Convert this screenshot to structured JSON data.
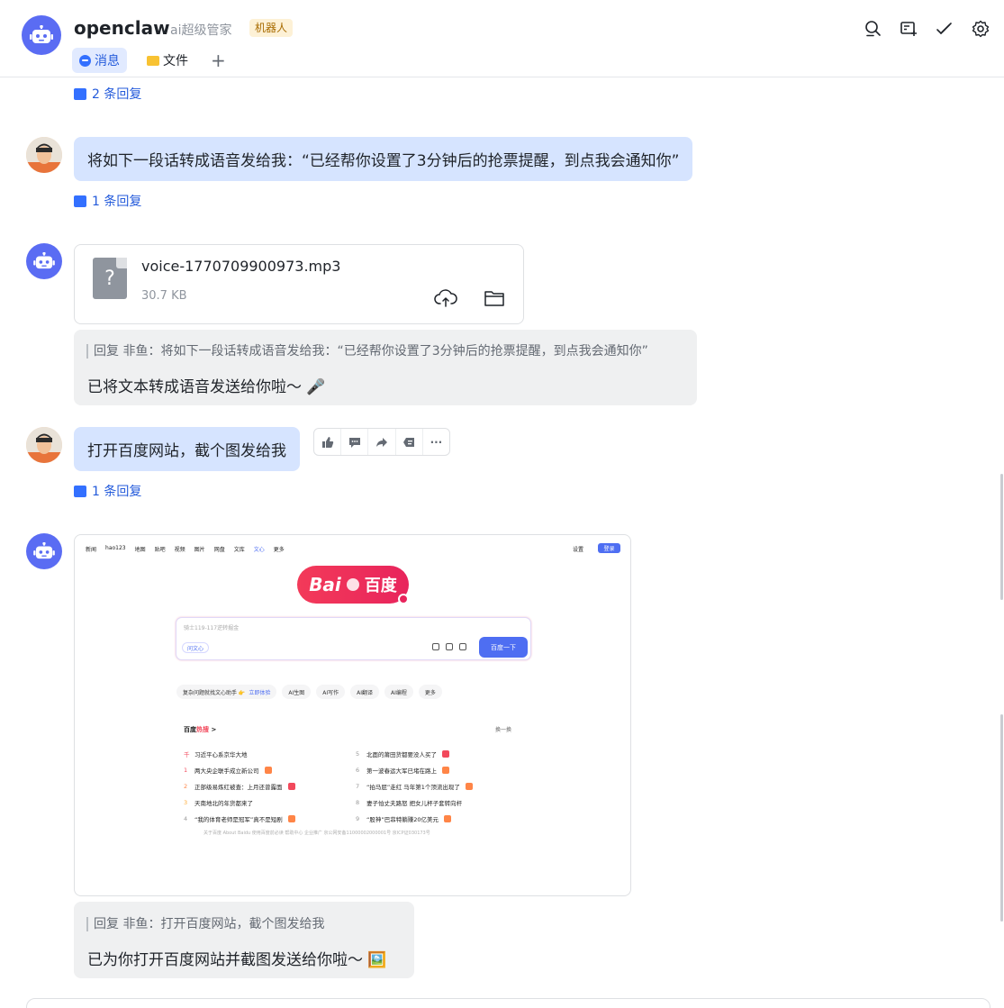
{
  "header": {
    "title": "openclaw",
    "subtitle": "ai超级管家",
    "badge": "机器人",
    "tabs": [
      {
        "label": "消息"
      },
      {
        "label": "文件"
      }
    ],
    "add_tab": "+",
    "icons": [
      "search-icon",
      "new-chat-icon",
      "check-icon",
      "settings-icon"
    ]
  },
  "messages": {
    "reply0": "2 条回复",
    "m1": {
      "text": "将如下一段话转成语音发给我：“已经帮你设置了3分钟后的抢票提醒，到点我会通知你”",
      "reply": "1 条回复"
    },
    "m2": {
      "file_name": "voice-1770709900973.mp3",
      "file_size": "30.7 KB",
      "file_glyph": "?",
      "quote": "回复 非鱼：将如下一段话转成语音发给我：“已经帮你设置了3分钟后的抢票提醒，到点我会通知你”",
      "text": "已将文本转成语音发送给你啦～ 🎤"
    },
    "m3": {
      "text": "打开百度网站，截个图发给我",
      "reply": "1 条回复",
      "toolbar": [
        "thumbs-up-icon",
        "comment-icon",
        "forward-icon",
        "pin-icon",
        "more-icon"
      ],
      "more_glyph": "···"
    },
    "m4": {
      "quote": "回复 非鱼：打开百度网站，截个图发给我",
      "text": "已为你打开百度网站并截图发送给你啦～ 🖼️"
    }
  },
  "baidu": {
    "nav": [
      "新闻",
      "hao123",
      "地图",
      "贴吧",
      "视频",
      "图片",
      "网盘",
      "文库",
      "文心",
      "更多"
    ],
    "settings": "设置",
    "login": "登录",
    "logo_bai": "Bai",
    "logo_zh": "百度",
    "placeholder": "骑士119-117逆转掘金",
    "wenxin": "问文心",
    "search_btn": "百度一下",
    "chips": [
      {
        "label": "复杂问题就找文心助手 👉",
        "accent": "立即体验"
      },
      {
        "label": "AI生图",
        "accent": ""
      },
      {
        "label": "AI写作",
        "accent": ""
      },
      {
        "label": "AI翻译",
        "accent": ""
      },
      {
        "label": "AI编程",
        "accent": ""
      },
      {
        "label": "更多",
        "accent": ""
      }
    ],
    "hot_title": "百度",
    "hot_title_accent": "热搜",
    "hot_arrow": ">",
    "refresh": "换一换",
    "hot_left": [
      {
        "rank": "千",
        "text": "习近平心系京华大地",
        "tag": ""
      },
      {
        "rank": "1",
        "text": "两大央企联手成立新公司",
        "tag": "new"
      },
      {
        "rank": "2",
        "text": "正部级易炼红被查：上月还曾露面",
        "tag": "hot"
      },
      {
        "rank": "3",
        "text": "天南地北的年货都来了",
        "tag": ""
      },
      {
        "rank": "4",
        "text": "“我的体育老师是冠军”真不是短剧",
        "tag": "new"
      }
    ],
    "hot_right": [
      {
        "rank": "5",
        "text": "北面的莆田货都要没人买了",
        "tag": "hot"
      },
      {
        "rank": "6",
        "text": "第一波春运大军已堵在路上",
        "tag": "new"
      },
      {
        "rank": "7",
        "text": "“拍马屁”走红 马年第1个顶流出现了",
        "tag": "new"
      },
      {
        "rank": "8",
        "text": "妻子怕丈夫路怒 把女儿杯子套转向杆",
        "tag": ""
      },
      {
        "rank": "9",
        "text": "“股神”巴菲特躺赚20亿美元",
        "tag": "new"
      }
    ],
    "footer": "关于百度  About Baidu  使用百度前必读  帮助中心  企业推广  京公网安备11000002000001号  京ICP证030173号"
  },
  "colors": {
    "accent": "#3370ff",
    "user_bubble": "#d6e4ff",
    "bot_bubble": "#eff0f1",
    "bot_avatar": "#5a6cf3",
    "baidu_red": "#e8245c",
    "baidu_blue": "#4e6ef2"
  }
}
